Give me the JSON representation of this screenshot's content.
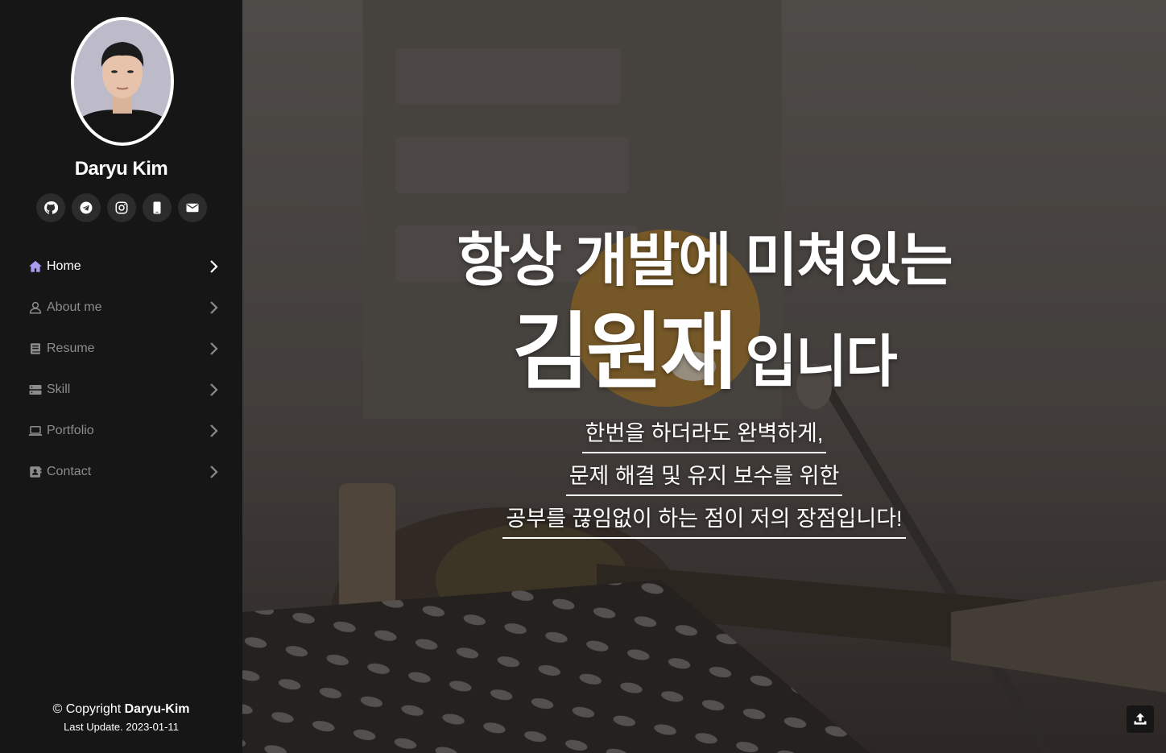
{
  "profile": {
    "name": "Daryu Kim",
    "avatar_description": "profile-photo"
  },
  "socials": [
    {
      "icon": "github-icon",
      "label": "GitHub"
    },
    {
      "icon": "telegram-icon",
      "label": "Telegram"
    },
    {
      "icon": "instagram-icon",
      "label": "Instagram"
    },
    {
      "icon": "phone-icon",
      "label": "Phone"
    },
    {
      "icon": "mail-icon",
      "label": "Email"
    }
  ],
  "nav": {
    "items": [
      {
        "label": "Home",
        "icon": "home-icon",
        "active": true
      },
      {
        "label": "About me",
        "icon": "user-icon",
        "active": false
      },
      {
        "label": "Resume",
        "icon": "book-icon",
        "active": false
      },
      {
        "label": "Skill",
        "icon": "server-icon",
        "active": false
      },
      {
        "label": "Portfolio",
        "icon": "laptop-icon",
        "active": false
      },
      {
        "label": "Contact",
        "icon": "contact-icon",
        "active": false
      }
    ]
  },
  "footer": {
    "copyright_prefix": "© Copyright ",
    "owner": "Daryu-Kim",
    "last_update": "Last Update. 2023-01-11"
  },
  "hero": {
    "headline_line1": "항상 개발에 미쳐있는",
    "headline_name": "김원재",
    "headline_suffix": "입니다",
    "taglines": [
      "한번을 하더라도 완벽하게,",
      "문제 해결 및 유지 보수를 위한",
      "공부를 끊임없이 하는 점이 저의 장점입니다!"
    ]
  },
  "colors": {
    "sidebar_bg": "#161616",
    "active_icon": "#a99bf0",
    "inactive_text": "#8c8c8c",
    "hero_text": "#ffffff"
  }
}
